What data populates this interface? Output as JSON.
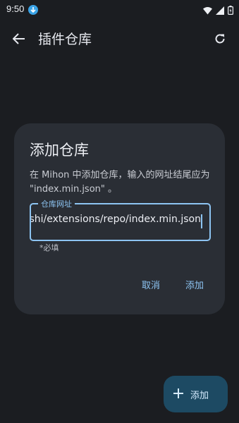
{
  "status_bar": {
    "time": "9:50"
  },
  "top_bar": {
    "title": "插件仓库"
  },
  "dialog": {
    "title": "添加仓库",
    "message": "在 Mihon 中添加仓库，输入的网址结尾应为 \"index.min.json\" 。",
    "field_label": "仓库网址",
    "field_value": "oushi/extensions/repo/index.min.json",
    "helper_text": "*必填",
    "cancel_label": "取消",
    "confirm_label": "添加"
  },
  "fab": {
    "label": "添加"
  },
  "colors": {
    "accent": "#8dc4f2",
    "dialog_bg": "#2a2e35",
    "fab_bg": "#1d4a63"
  }
}
